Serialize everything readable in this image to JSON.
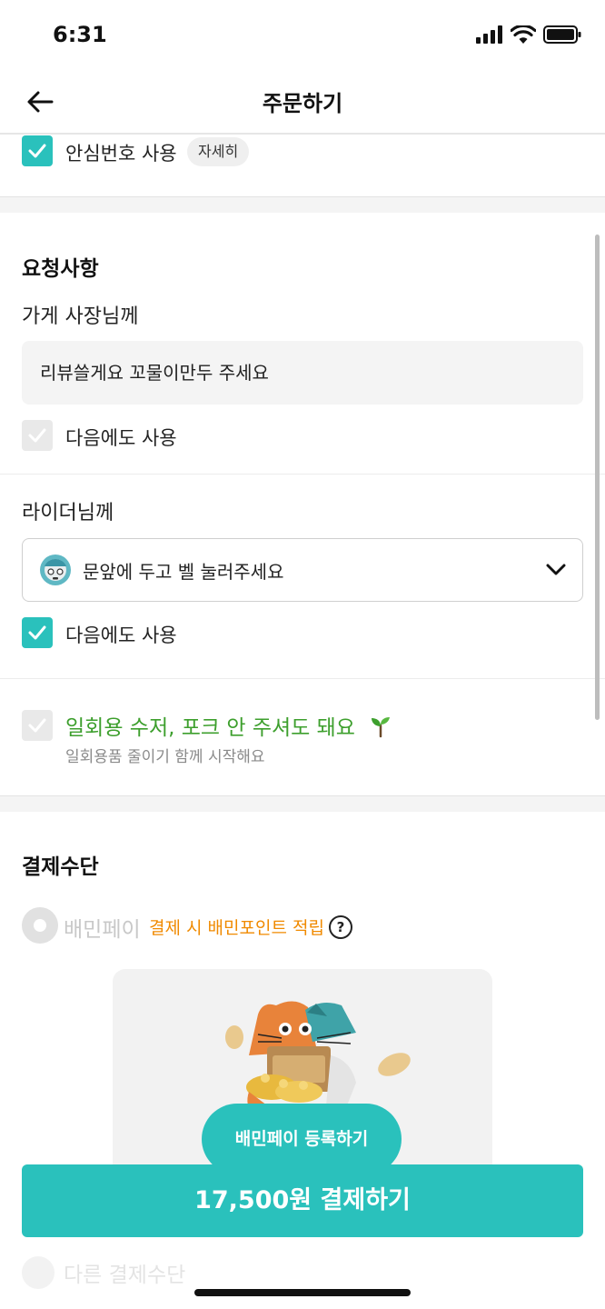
{
  "status_bar": {
    "time": "6:31"
  },
  "header": {
    "title": "주문하기"
  },
  "safe_number": {
    "label": "안심번호 사용",
    "checked": true,
    "detail_label": "자세히"
  },
  "requests": {
    "title": "요청사항",
    "store": {
      "label": "가게 사장님께",
      "value": "리뷰쓸게요 꼬물이만두 주세요",
      "reuse_label": "다음에도 사용",
      "reuse_checked": false
    },
    "rider": {
      "label": "라이더님께",
      "selected": "문앞에 두고 벨 눌러주세요",
      "reuse_label": "다음에도 사용",
      "reuse_checked": true
    },
    "no_utensils": {
      "label": "일회용 수저, 포크 안 주셔도 돼요",
      "sub": "일회용품 줄이기 함께 시작해요",
      "checked": false
    }
  },
  "payment": {
    "title": "결제수단",
    "baemin_pay": {
      "label": "배민페이",
      "promo": "결제 시 배민포인트 적립",
      "help_icon": "?"
    },
    "register_label": "배민페이 등록하기",
    "other_label": "다른 결제수단"
  },
  "checkout": {
    "label": "17,500원 결제하기"
  },
  "colors": {
    "accent": "#2ac1bc",
    "promo": "#f08a00",
    "eco_green": "#3d9f2d"
  }
}
